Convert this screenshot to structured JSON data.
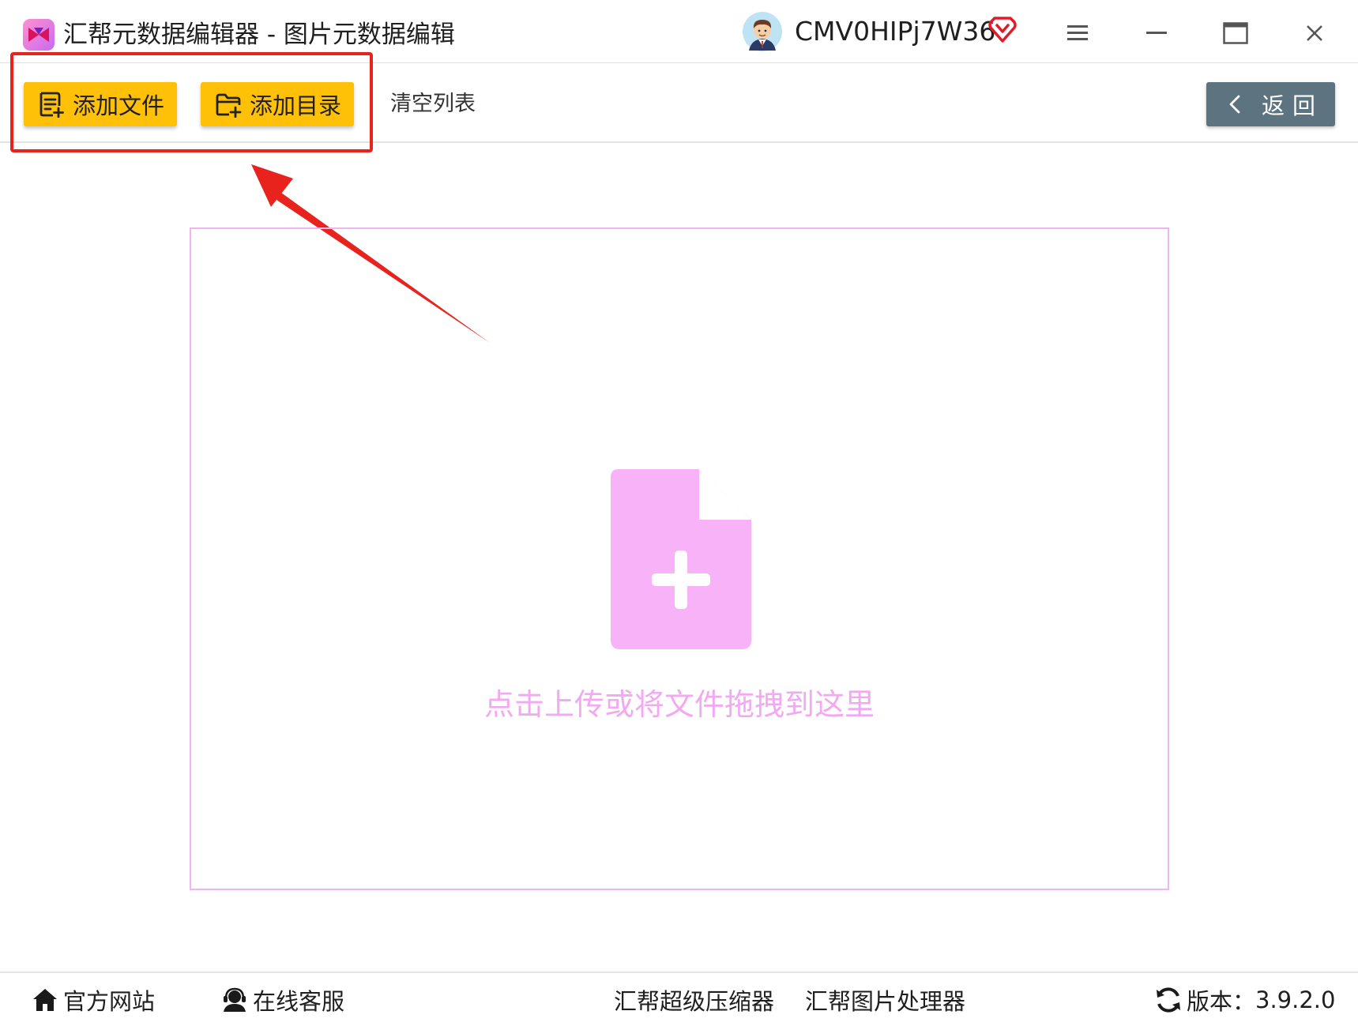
{
  "window": {
    "title": "汇帮元数据编辑器 - 图片元数据编辑",
    "username": "CMV0HIPj7W36"
  },
  "toolbar": {
    "add_file_label": "添加文件",
    "add_dir_label": "添加目录",
    "clear_list_label": "清空列表",
    "back_label": "返回"
  },
  "drop_zone": {
    "hint": "点击上传或将文件拖拽到这里"
  },
  "footer": {
    "website_label": "官方网站",
    "support_label": "在线客服",
    "compressor_label": "汇帮超级压缩器",
    "image_processor_label": "汇帮图片处理器",
    "version_label": "版本：",
    "version_value": "3.9.2.0"
  },
  "icons": {
    "app_logo": "app-logo-icon",
    "avatar": "avatar-icon",
    "vip": "vip-heart-icon",
    "menu": "hamburger-menu-icon",
    "minimize": "minimize-icon",
    "maximize": "maximize-icon",
    "close": "close-icon",
    "add_file": "add-file-icon",
    "add_dir": "add-folder-icon",
    "back": "chevron-left-icon",
    "upload": "file-plus-icon",
    "home": "home-icon",
    "support": "headset-user-icon",
    "refresh": "refresh-icon"
  },
  "colors": {
    "accent_yellow": "#ffc107",
    "back_button": "#5d7480",
    "drop_zone_border": "#f0b4f2",
    "upload_icon": "#f7b2f8",
    "hint_text": "#f2a9f1",
    "annotation_red": "#e8231e"
  }
}
